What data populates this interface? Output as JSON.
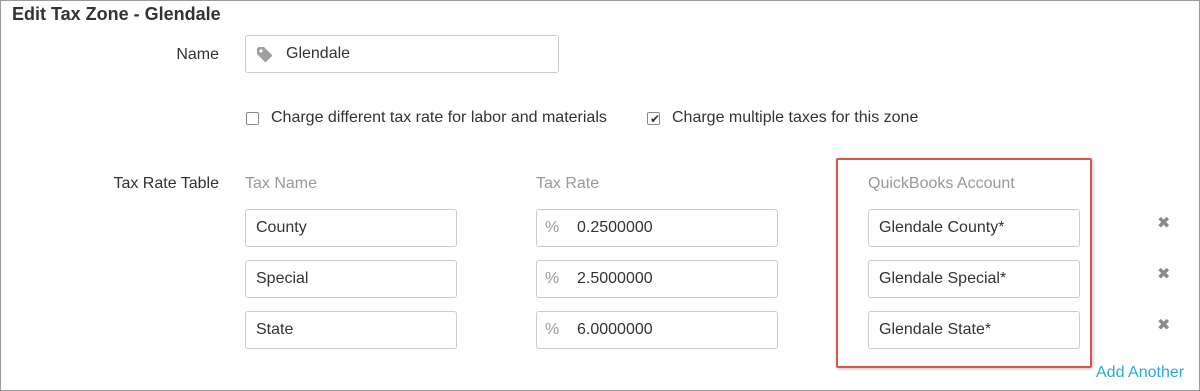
{
  "page": {
    "title": "Edit Tax Zone - Glendale"
  },
  "name_field": {
    "label": "Name",
    "value": "Glendale",
    "icon": "tag-icon"
  },
  "options": {
    "labor_materials": {
      "label": "Charge different tax rate for labor and materials",
      "checked": false
    },
    "multiple_taxes": {
      "label": "Charge multiple taxes for this zone",
      "checked": true
    }
  },
  "tax_table": {
    "label": "Tax Rate Table",
    "columns": [
      "Tax Name",
      "Tax Rate",
      "QuickBooks Account"
    ],
    "rate_prefix": "%",
    "rows": [
      {
        "name": "County",
        "rate": "0.2500000",
        "account": "Glendale County*"
      },
      {
        "name": "Special",
        "rate": "2.5000000",
        "account": "Glendale Special*"
      },
      {
        "name": "State",
        "rate": "6.0000000",
        "account": "Glendale State*"
      }
    ],
    "remove_glyph": "✖",
    "add_label": "Add Another"
  },
  "colors": {
    "highlight_border": "#d9534f",
    "link": "#2aa9d6",
    "muted": "#999999"
  }
}
